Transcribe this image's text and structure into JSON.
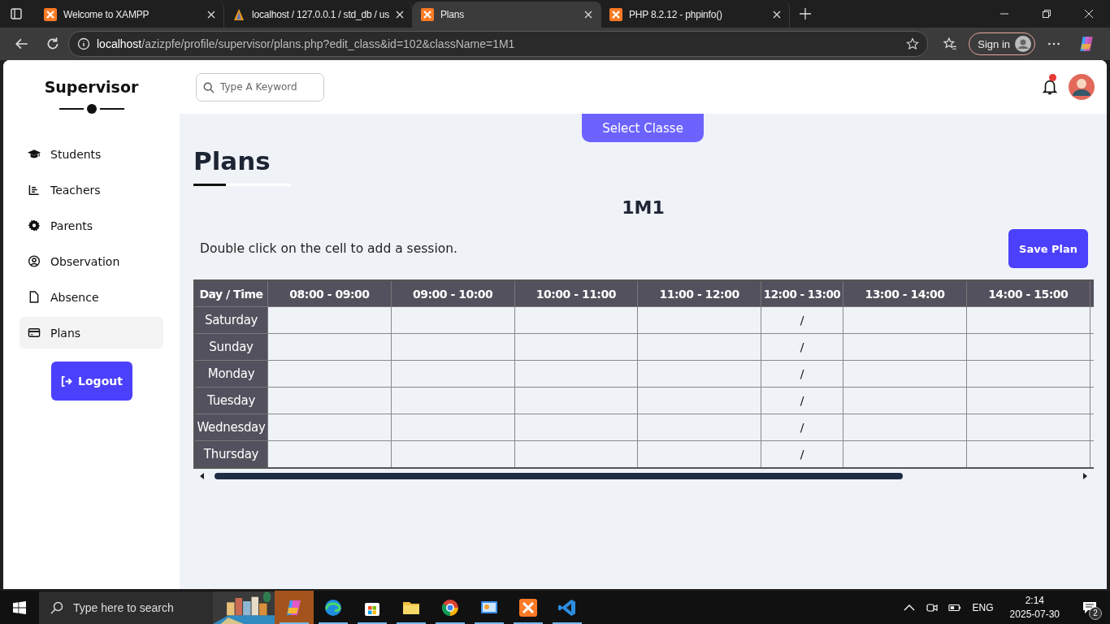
{
  "browser": {
    "tabs": [
      {
        "title": "Welcome to XAMPP",
        "selected": false
      },
      {
        "title": "localhost / 127.0.0.1 / std_db / us",
        "selected": false
      },
      {
        "title": "Plans",
        "selected": true
      },
      {
        "title": "PHP 8.2.12 - phpinfo()",
        "selected": false
      }
    ],
    "address": {
      "host": "localhost",
      "path": "/azizpfe/profile/supervisor/plans.php?edit_class&id=102&className=1M1"
    },
    "sign_in": "Sign in"
  },
  "sidebar": {
    "title": "Supervisor",
    "items": [
      {
        "label": "Students",
        "selected": false
      },
      {
        "label": "Teachers",
        "selected": false
      },
      {
        "label": "Parents",
        "selected": false
      },
      {
        "label": "Observation",
        "selected": false
      },
      {
        "label": "Absence",
        "selected": false
      },
      {
        "label": "Plans",
        "selected": true
      }
    ],
    "logout": "Logout"
  },
  "header": {
    "search": {
      "placeholder": "Type A Keyword"
    },
    "notification": true
  },
  "content": {
    "select_button": "Select Classe",
    "title": "Plans",
    "class_name": "1M1",
    "hint": "Double click on the cell to add a session.",
    "save_button": "Save Plan",
    "table": {
      "corner": "Day / Time",
      "columns": [
        {
          "label": "08:00 - 09:00",
          "kind": "slot"
        },
        {
          "label": "09:00 - 10:00",
          "kind": "slot"
        },
        {
          "label": "10:00 - 11:00",
          "kind": "slot"
        },
        {
          "label": "11:00 - 12:00",
          "kind": "slot"
        },
        {
          "label": "12:00 - 13:00",
          "kind": "break"
        },
        {
          "label": "13:00 - 14:00",
          "kind": "slot"
        },
        {
          "label": "14:00 - 15:00",
          "kind": "slot"
        }
      ],
      "rows": [
        {
          "day": "Saturday",
          "break_cell": "/"
        },
        {
          "day": "Sunday",
          "break_cell": "/"
        },
        {
          "day": "Monday",
          "break_cell": "/"
        },
        {
          "day": "Tuesday",
          "break_cell": "/"
        },
        {
          "day": "Wednesday",
          "break_cell": "/"
        },
        {
          "day": "Thursday",
          "break_cell": "/"
        }
      ]
    }
  },
  "taskbar": {
    "search_placeholder": "Type here to search",
    "apps": [
      {
        "selected": true
      },
      {
        "selected": false
      },
      {
        "selected": false
      },
      {
        "selected": false
      },
      {
        "selected": false
      },
      {
        "selected": false
      },
      {
        "selected": false
      },
      {
        "selected": false
      }
    ],
    "language": "ENG",
    "time": "2:14",
    "date": "2025-07-30",
    "notifications": "2"
  }
}
